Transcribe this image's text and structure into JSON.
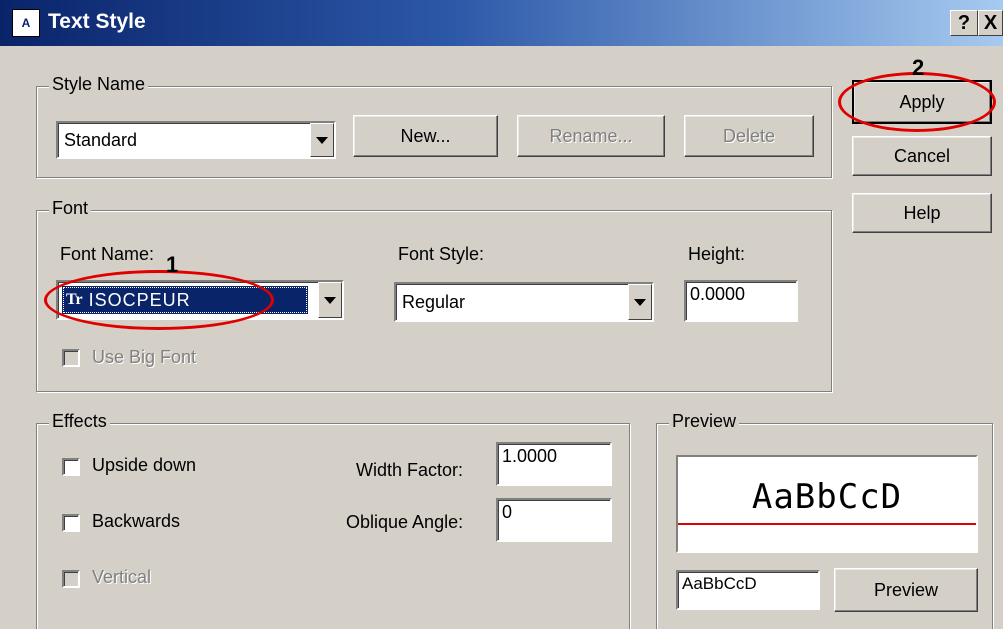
{
  "window": {
    "title": "Text Style",
    "help_button": "?",
    "close_button": "X",
    "icon_text": "A"
  },
  "style_name": {
    "group_label": "Style Name",
    "selected": "Standard",
    "new_label": "New...",
    "rename_label": "Rename...",
    "delete_label": "Delete"
  },
  "side_buttons": {
    "apply_label": "Apply",
    "cancel_label": "Cancel",
    "help_label": "Help"
  },
  "font": {
    "group_label": "Font",
    "font_name_label": "Font Name:",
    "font_name_value": "ISOCPEUR",
    "font_name_icon": "Tr",
    "font_style_label": "Font Style:",
    "font_style_value": "Regular",
    "height_label": "Height:",
    "height_value": "0.0000",
    "use_big_font_label": "Use Big Font"
  },
  "effects": {
    "group_label": "Effects",
    "upside_down_label": "Upside down",
    "backwards_label": "Backwards",
    "vertical_label": "Vertical",
    "width_factor_label": "Width Factor:",
    "width_factor_value": "1.0000",
    "oblique_angle_label": "Oblique Angle:",
    "oblique_angle_value": "0"
  },
  "preview": {
    "group_label": "Preview",
    "sample_text": "AaBbCcD",
    "input_value": "AaBbCcD",
    "button_label": "Preview"
  },
  "annotations": {
    "marker_1": "1",
    "marker_2": "2",
    "color": "#e00000"
  }
}
